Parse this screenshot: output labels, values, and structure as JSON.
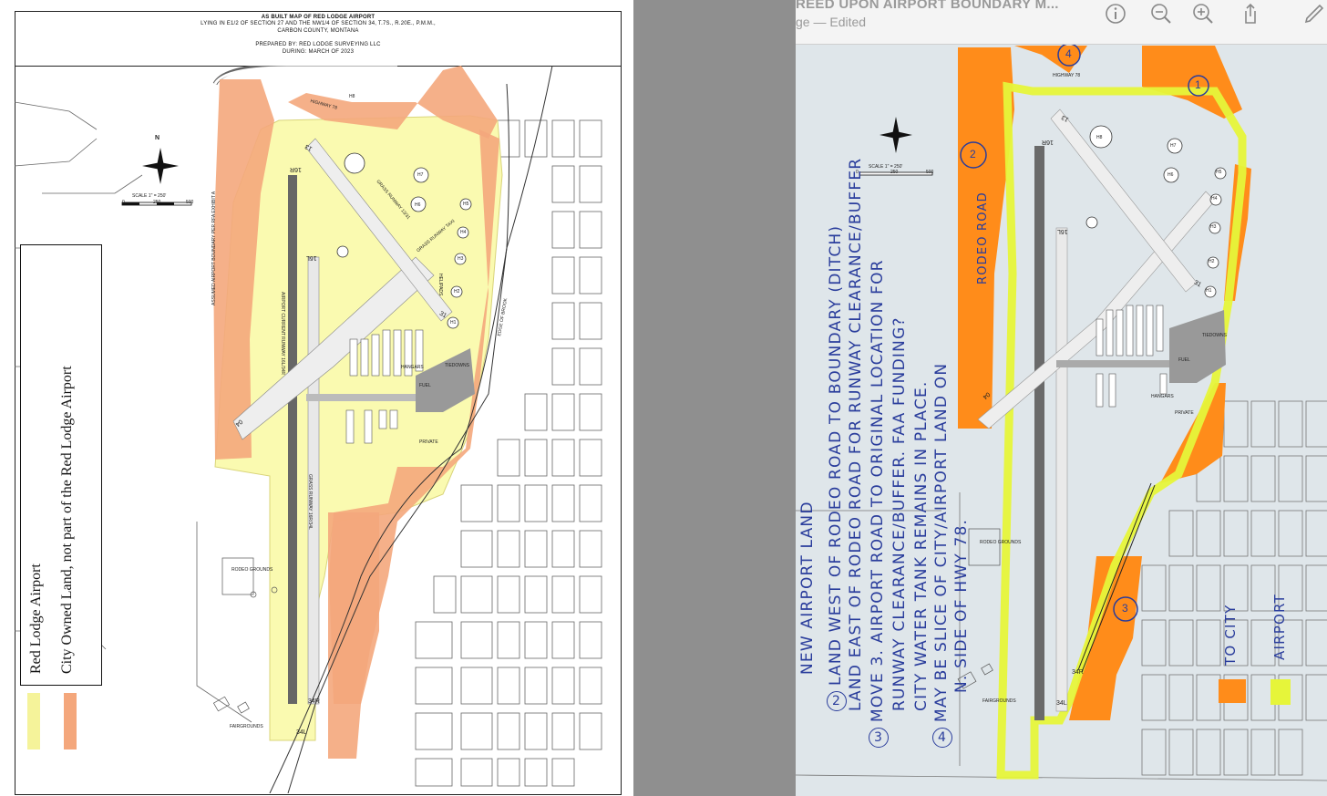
{
  "left_map": {
    "title_lines": [
      "AS BUILT MAP OF RED LODGE AIRPORT",
      "LYING IN E1/2 OF SECTION 27 AND THE NW1/4 OF SECTION 34, T.7S., R.20E., P.M.M.,",
      "CARBON COUNTY, MONTANA",
      "PREPARED BY: RED LODGE SURVEYING LLC",
      "DURING: MARCH OF 2023"
    ],
    "legend": {
      "airport_label": "Red Lodge Airport",
      "city_label": "City Owned Land, not part of the Red Lodge Airport",
      "airport_color": "#f5f39a",
      "city_color": "#f4a77c"
    },
    "north_label": "N",
    "scale_label": "SCALE 1\" = 250'",
    "scale_ticks": [
      "0",
      "250",
      "500"
    ],
    "highway_label": "HIGHWAY 78",
    "runway_ends": [
      "16R",
      "16L",
      "34R",
      "34L",
      "13",
      "31",
      "04"
    ],
    "grass_runway_label": "GRASS RUNWAY 16R/34L",
    "grass_runway_diag": "GRASS RUNWAY 13/31",
    "grass_taxi": "GRASS RUNWAY TAXI",
    "heli_pads": [
      "H1",
      "H2",
      "H3",
      "H4",
      "H5",
      "H6",
      "H7",
      "H8"
    ],
    "heliport_label": "HELIPADS",
    "labels": [
      "HANGARS",
      "FUEL",
      "TIEDOWNS",
      "PRIVATE",
      "RODEO GROUNDS",
      "FAIRGROUNDS",
      "AIRPORT CURRENT RUNWAY 16L/34R",
      "ASSUMED AIRPORT BOUNDARY PER RFA EXHIBIT A",
      "EDGE OF BROOK"
    ]
  },
  "right_view": {
    "window_title": "REED UPON AIRPORT BOUNDARY M...",
    "subtitle": "ge — Edited",
    "toolbar": {
      "info": "info-icon",
      "zoom_out": "zoom-out-icon",
      "zoom_in": "zoom-in-icon",
      "share": "share-icon",
      "markup": "markup-icon"
    },
    "map_labels": [
      "16R",
      "16L",
      "34R",
      "34L",
      "13",
      "31",
      "04",
      "H1",
      "H2",
      "H3",
      "H4",
      "H5",
      "H6",
      "H7",
      "H8",
      "HANGARS",
      "FUEL",
      "TIEDOWNS",
      "PRIVATE",
      "RODEO GROUNDS",
      "FAIRGROUNDS",
      "HIGHWAY 78"
    ],
    "scale_label": "SCALE 1\" = 250'",
    "scale_ticks": [
      "0",
      "250",
      "500"
    ],
    "circled_numbers": [
      "1",
      "2",
      "3",
      "4"
    ],
    "rodeo_road": "RODEO ROAD",
    "notes": {
      "top_cutoff": "NEW   AIRPORT   LAND",
      "n2_line1": "LAND  WEST  OF  RODEO  ROAD  TO  BOUNDARY (DITCH)",
      "n2_line2": "LAND  EAST  OF  RODEO  ROAD  FOR  RUNWAY  CLEARANCE/BUFFER",
      "n3_line1": "MOVE   3.  AIRPORT  ROAD  TO  ORIGINAL  LOCATION  FOR",
      "n3_line2": "RUNWAY   CLEARANCE/BUFFER.  FAA  FUNDING?",
      "n3_line3": "CITY   WATER   TANK   REMAINS  IN  PLACE.",
      "n4_line1": "MAY  BE  SLICE  OF  CITY/AIRPORT  LAND  ON",
      "n4_line2": "N. SIDE  OF  HWY  78.",
      "n2_num": "2",
      "n3_num": "3",
      "n4_num": "4"
    },
    "legend_to_city": "TO CITY",
    "legend_airport": "AIRPORT",
    "highlight_orange": "#ff8c1a",
    "highlight_yellow": "#e6f53a"
  }
}
